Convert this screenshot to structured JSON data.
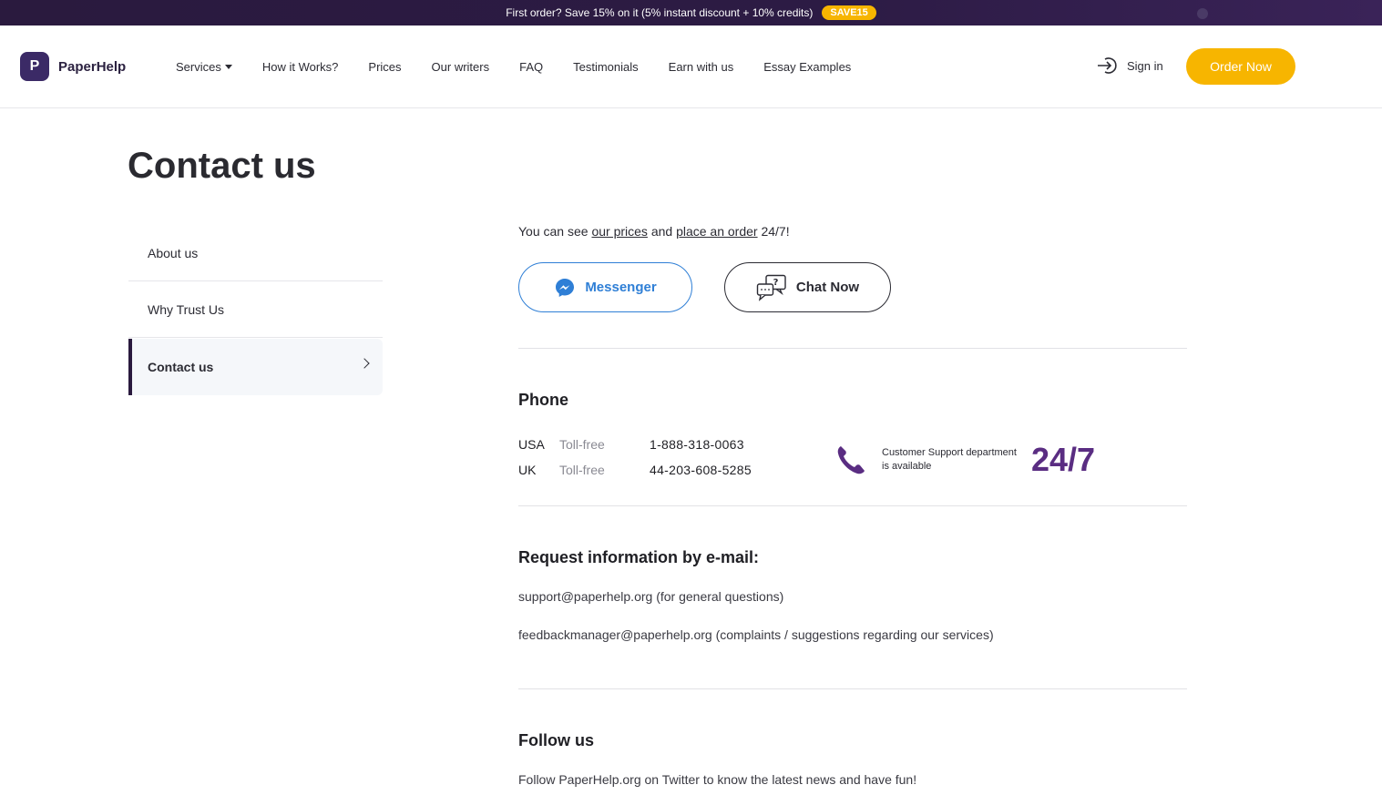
{
  "promo": {
    "text": "First order? Save 15% on it (5% instant discount + 10% credits)",
    "code": "SAVE15"
  },
  "header": {
    "brand_initial": "P",
    "brand_name": "PaperHelp",
    "menu": [
      {
        "label": "Services",
        "has_dropdown": true
      },
      {
        "label": "How it Works?"
      },
      {
        "label": "Prices"
      },
      {
        "label": "Our writers"
      },
      {
        "label": "FAQ"
      },
      {
        "label": "Testimonials"
      },
      {
        "label": "Earn with us"
      },
      {
        "label": "Essay Examples"
      }
    ],
    "signin_label": "Sign in",
    "order_label": "Order Now"
  },
  "page": {
    "title": "Contact us"
  },
  "sidebar": {
    "items": [
      {
        "label": "About us"
      },
      {
        "label": "Why Trust Us"
      },
      {
        "label": "Contact us",
        "active": true
      }
    ]
  },
  "contact": {
    "intro_prefix": "You can see",
    "intro_link_prices": "our prices",
    "intro_and": "and",
    "intro_link_order": "place an order",
    "intro_suffix": "24/7!",
    "messenger_label": "Messenger",
    "chat_label": "Chat Now",
    "phone_heading": "Phone",
    "phones": [
      {
        "country": "USA",
        "type": "Toll-free",
        "number": "1-888-318-0063"
      },
      {
        "country": "UK",
        "type": "Toll-free",
        "number": "44-203-608-5285"
      }
    ],
    "support_text": "Customer Support department is available",
    "support_hours": "24/7",
    "email_heading": "Request information by e-mail:",
    "emails": [
      "support@paperhelp.org (for general questions)",
      "feedbackmanager@paperhelp.org (complaints / suggestions regarding our services)"
    ],
    "follow_heading": "Follow us",
    "follow_text": "Follow PaperHelp.org on Twitter to know the latest news and have fun!"
  },
  "colors": {
    "promo_bg": "#2a1a3e",
    "accent_yellow": "#f7b500",
    "brand_purple": "#3b2a66",
    "messenger_blue": "#2f7fd6",
    "support_purple": "#5a2d82"
  }
}
